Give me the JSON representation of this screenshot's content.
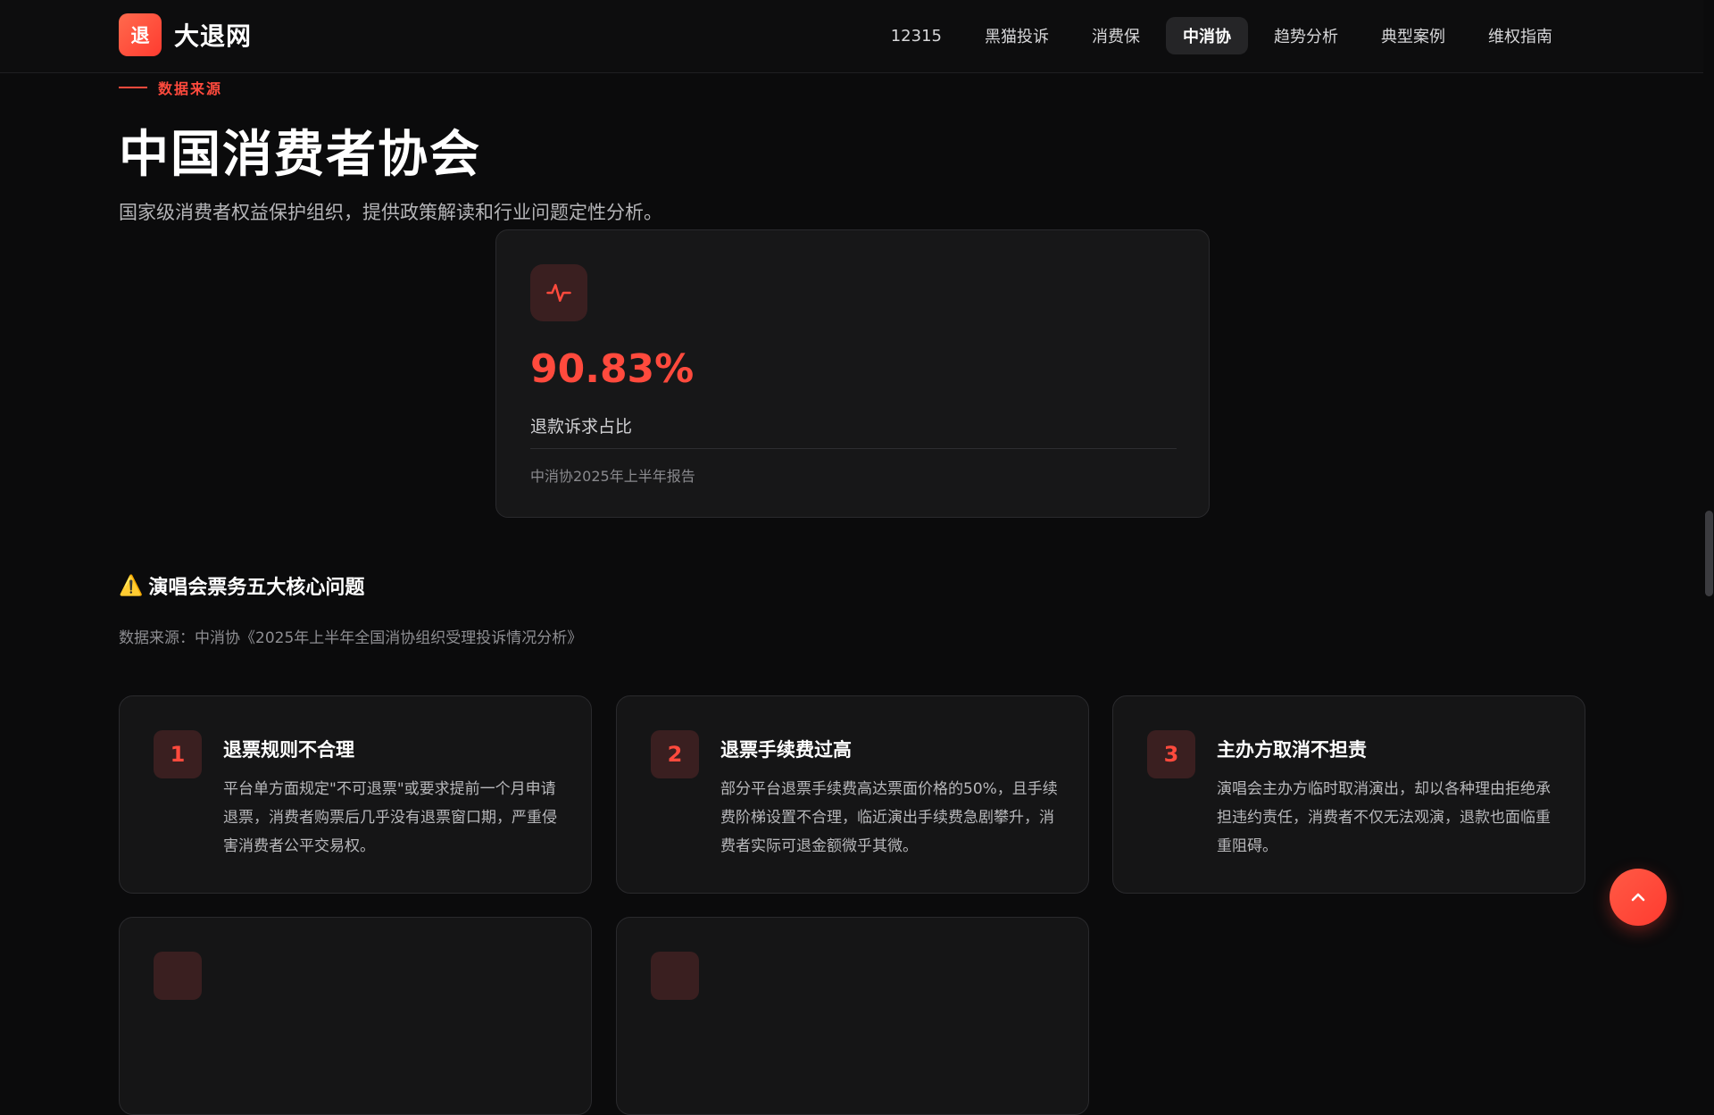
{
  "header": {
    "logo_char": "退",
    "logo_text": "大退网",
    "nav": [
      {
        "label": "12315",
        "active": false
      },
      {
        "label": "黑猫投诉",
        "active": false
      },
      {
        "label": "消费保",
        "active": false
      },
      {
        "label": "中消协",
        "active": true
      },
      {
        "label": "趋势分析",
        "active": false
      },
      {
        "label": "典型案例",
        "active": false
      },
      {
        "label": "维权指南",
        "active": false
      }
    ]
  },
  "hero": {
    "eyebrow": "数据来源",
    "title": "中国消费者协会",
    "description": "国家级消费者权益保护组织，提供政策解读和行业问题定性分析。"
  },
  "stat": {
    "icon": "activity-pulse-icon",
    "value": "90.83%",
    "label": "退款诉求占比",
    "source": "中消协2025年上半年报告"
  },
  "issues_section": {
    "warn_icon": "⚠️",
    "title": "演唱会票务五大核心问题",
    "source": "数据来源：中消协《2025年上半年全国消协组织受理投诉情况分析》",
    "items": [
      {
        "num": "1",
        "title": "退票规则不合理",
        "body": "平台单方面规定\"不可退票\"或要求提前一个月申请退票，消费者购票后几乎没有退票窗口期，严重侵害消费者公平交易权。"
      },
      {
        "num": "2",
        "title": "退票手续费过高",
        "body": "部分平台退票手续费高达票面价格的50%，且手续费阶梯设置不合理，临近演出手续费急剧攀升，消费者实际可退金额微乎其微。"
      },
      {
        "num": "3",
        "title": "主办方取消不担责",
        "body": "演唱会主办方临时取消演出，却以各种理由拒绝承担违约责任，消费者不仅无法观演，退款也面临重重阻碍。"
      }
    ]
  },
  "colors": {
    "accent": "#ff4a3d",
    "background": "#0b0b0c",
    "card": "#151516"
  }
}
